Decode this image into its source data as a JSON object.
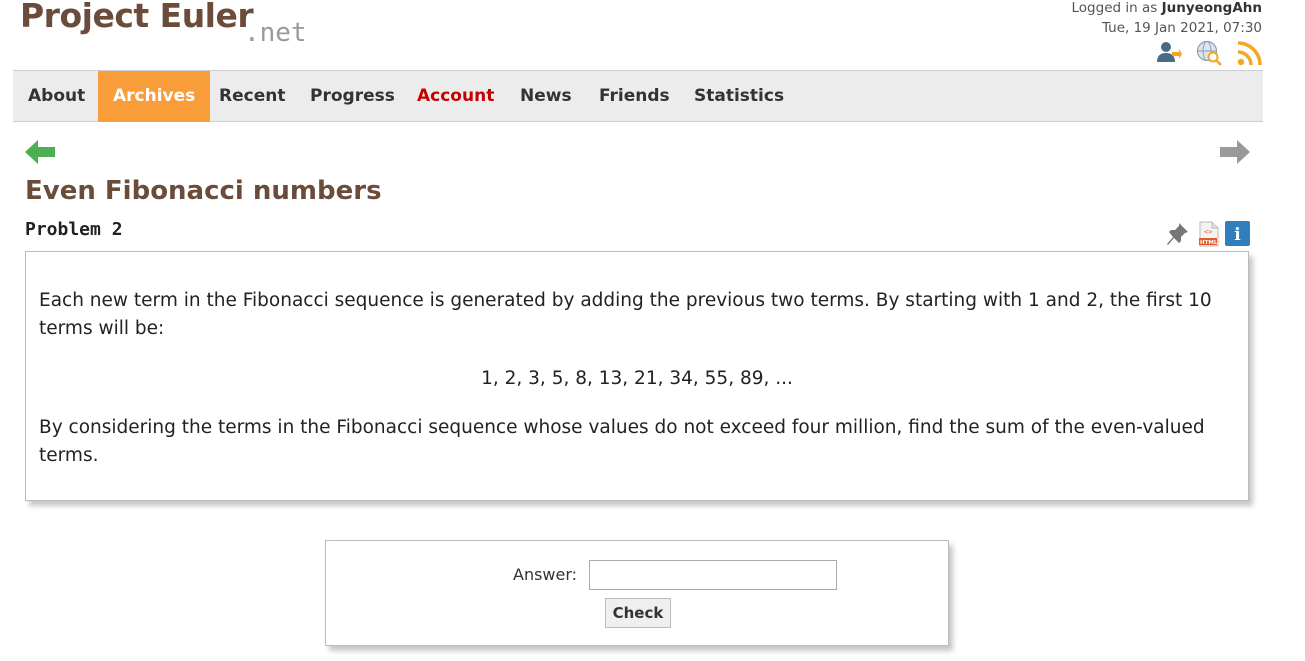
{
  "site": {
    "logo_main": "Project Euler",
    "logo_tld": ".net"
  },
  "user": {
    "logged_in_prefix": "Logged in as",
    "username": "JunyeongAhn",
    "datetime": "Tue, 19 Jan 2021, 07:30"
  },
  "header_icons": [
    "account-icon",
    "globe-search-icon",
    "rss-feed-icon"
  ],
  "nav": {
    "items": [
      {
        "label": "About"
      },
      {
        "label": "Archives",
        "active": true
      },
      {
        "label": "Recent"
      },
      {
        "label": "Progress"
      },
      {
        "label": "Account",
        "highlight": "red"
      },
      {
        "label": "News"
      },
      {
        "label": "Friends"
      },
      {
        "label": "Statistics"
      }
    ]
  },
  "problem": {
    "title": "Even Fibonacci numbers",
    "number_label": "Problem 2",
    "paragraph_1": "Each new term in the Fibonacci sequence is generated by adding the previous two terms. By starting with 1 and 2, the first 10 terms will be:",
    "sequence": "1, 2, 3, 5, 8, 13, 21, 34, 55, 89, ...",
    "paragraph_2": "By considering the terms in the Fibonacci sequence whose values do not exceed four million, find the sum of the even-valued terms."
  },
  "tools": {
    "html_badge": "HTML",
    "info_glyph": "i"
  },
  "answer": {
    "label": "Answer:",
    "value": "",
    "check_label": "Check"
  },
  "colors": {
    "brand_brown": "#6b4c3b",
    "active_tab": "#f99d3a",
    "account_red": "#c50000",
    "prev_arrow": "#4caf50",
    "next_arrow": "#999999",
    "info_blue": "#2f7fbf",
    "rss_orange": "#f5a623"
  }
}
